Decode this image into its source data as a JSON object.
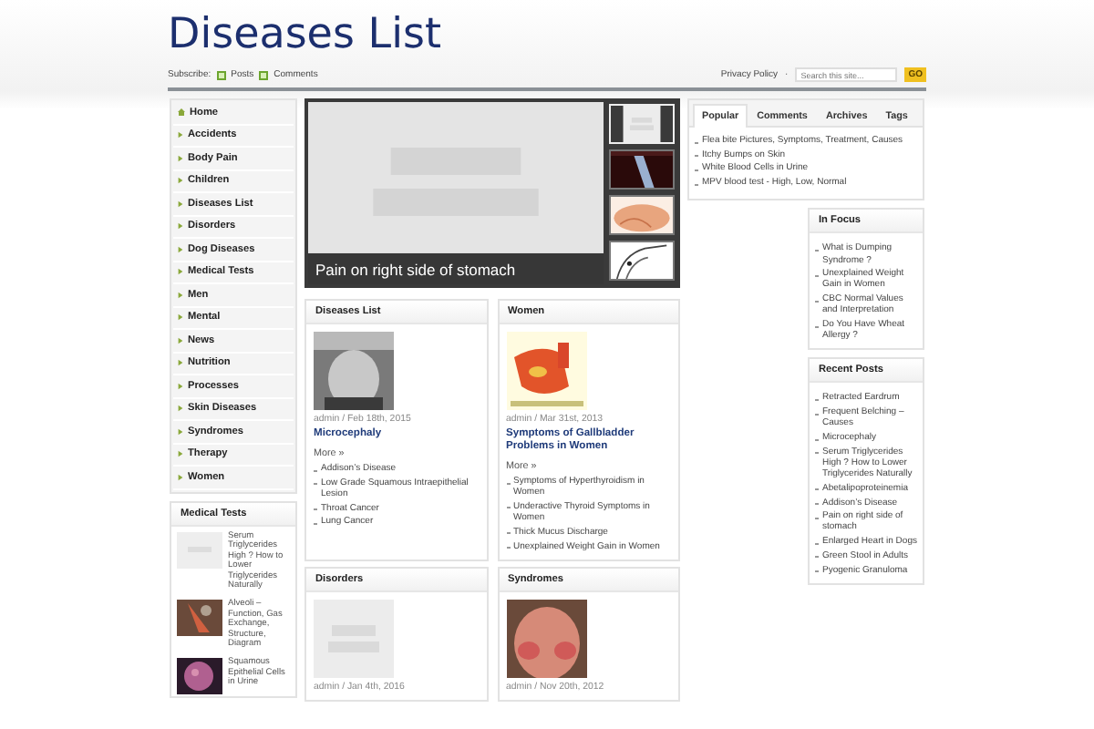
{
  "header": {
    "title": "Diseases List",
    "subscribe_label": "Subscribe:",
    "feeds": [
      "Posts",
      "Comments"
    ],
    "top_links": [
      "Privacy Policy"
    ],
    "separator": "·",
    "search": {
      "placeholder": "Search this site..."
    },
    "search_button": "GO"
  },
  "nav": {
    "items": [
      {
        "label": "Home",
        "kind": "home"
      },
      {
        "label": "Accidents",
        "kind": "category"
      },
      {
        "label": "Body Pain",
        "kind": "category"
      },
      {
        "label": "Children",
        "kind": "category"
      },
      {
        "label": "Diseases List",
        "kind": "category"
      },
      {
        "label": "Disorders",
        "kind": "category"
      },
      {
        "label": "Dog Diseases",
        "kind": "category"
      },
      {
        "label": "Medical Tests",
        "kind": "category"
      },
      {
        "label": "Men",
        "kind": "category"
      },
      {
        "label": "Mental",
        "kind": "category"
      },
      {
        "label": "News",
        "kind": "category"
      },
      {
        "label": "Nutrition",
        "kind": "category"
      },
      {
        "label": "Processes",
        "kind": "category"
      },
      {
        "label": "Skin Diseases",
        "kind": "category"
      },
      {
        "label": "Syndromes",
        "kind": "category"
      },
      {
        "label": "Therapy",
        "kind": "category"
      },
      {
        "label": "Women",
        "kind": "category"
      }
    ]
  },
  "sidebar_widget": {
    "title": "Medical Tests",
    "posts": [
      {
        "title": "Serum Triglycerides High ? How to Lower Triglycerides Naturally"
      },
      {
        "title": "Alveoli – Function, Gas Exchange, Structure, Diagram"
      },
      {
        "title": "Squamous Epithelial Cells in Urine"
      }
    ]
  },
  "featured": {
    "caption": "Pain on right side of stomach",
    "thumbs": [
      {
        "selected": true
      },
      {
        "selected": false
      },
      {
        "selected": false
      },
      {
        "selected": false
      }
    ]
  },
  "categories": [
    {
      "title": "Diseases List",
      "meta": "admin / Feb 18th, 2015",
      "post_title": "Microcephaly",
      "more": "More »",
      "links": [
        "Addison’s Disease",
        "Low Grade Squamous Intraepithelial Lesion",
        "Throat Cancer",
        "Lung Cancer"
      ]
    },
    {
      "title": "Women",
      "meta": "admin / Mar 31st, 2013",
      "post_title": "Symptoms of Gallbladder Problems in Women",
      "more": "More »",
      "links": [
        "Symptoms of Hyperthyroidism in Women",
        "Underactive Thyroid Symptoms in Women",
        "Thick Mucus Discharge",
        "Unexplained Weight Gain in Women"
      ]
    },
    {
      "title": "Disorders",
      "meta": "admin / Jan 4th, 2016"
    },
    {
      "title": "Syndromes",
      "meta": "admin / Nov 20th, 2012"
    }
  ],
  "tabs": [
    {
      "label": "Popular",
      "selected": true
    },
    {
      "label": "Comments",
      "selected": false
    },
    {
      "label": "Archives",
      "selected": false
    },
    {
      "label": "Tags",
      "selected": false
    }
  ],
  "popular": [
    "Flea bite Pictures, Symptoms, Treatment, Causes",
    "Itchy Bumps on Skin",
    "White Blood Cells in Urine",
    "MPV blood test - High, Low, Normal"
  ],
  "in_focus": {
    "title": "In Focus",
    "items": [
      "What is Dumping Syndrome ?",
      "Unexplained Weight Gain in Women",
      "CBC Normal Values and Interpretation",
      "Do You Have Wheat Allergy ?"
    ]
  },
  "recent_posts": {
    "title": "Recent Posts",
    "items": [
      "Retracted Eardrum",
      "Frequent Belching – Causes",
      "Microcephaly",
      "Serum Triglycerides High ? How to Lower Triglycerides Naturally",
      "Abetalipoproteinemia",
      "Addison’s Disease",
      "Pain on right side of stomach",
      "Enlarged Heart in Dogs",
      "Green Stool in Adults",
      "Pyogenic Granuloma"
    ]
  }
}
